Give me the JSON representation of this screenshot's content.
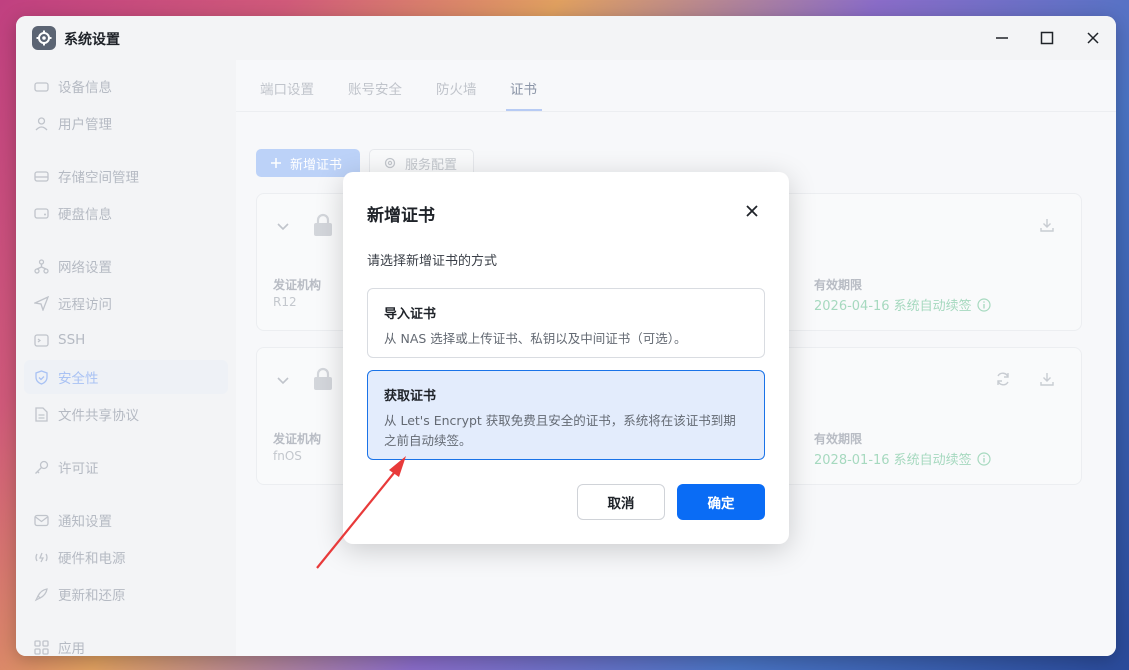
{
  "window": {
    "title": "系统设置"
  },
  "sidebar": {
    "items": [
      {
        "label": "设备信息",
        "icon": "device-icon"
      },
      {
        "label": "用户管理",
        "icon": "user-icon"
      },
      {
        "label": "存储空间管理",
        "icon": "storage-icon"
      },
      {
        "label": "硬盘信息",
        "icon": "disk-icon"
      },
      {
        "label": "网络设置",
        "icon": "network-icon"
      },
      {
        "label": "远程访问",
        "icon": "send-icon"
      },
      {
        "label": "SSH",
        "icon": "terminal-icon"
      },
      {
        "label": "安全性",
        "icon": "shield-icon",
        "active": true
      },
      {
        "label": "文件共享协议",
        "icon": "file-icon"
      },
      {
        "label": "许可证",
        "icon": "key-icon"
      },
      {
        "label": "通知设置",
        "icon": "mail-icon"
      },
      {
        "label": "硬件和电源",
        "icon": "power-icon"
      },
      {
        "label": "更新和还原",
        "icon": "rocket-icon"
      },
      {
        "label": "应用",
        "icon": "apps-icon"
      }
    ]
  },
  "tabs": [
    {
      "label": "端口设置"
    },
    {
      "label": "账号安全"
    },
    {
      "label": "防火墙"
    },
    {
      "label": "证书",
      "active": true
    }
  ],
  "toolbar": {
    "add_label": "新增证书",
    "service_label": "服务配置"
  },
  "certs": [
    {
      "issuer_label": "发证机构",
      "issuer": "R12",
      "expiry_label": "有效期限",
      "expiry": "2026-04-16 系统自动续签"
    },
    {
      "issuer_label": "发证机构",
      "issuer": "fnOS",
      "expiry_label": "有效期限",
      "expiry": "2028-01-16 系统自动续签"
    }
  ],
  "dialog": {
    "title": "新增证书",
    "subtitle": "请选择新增证书的方式",
    "options": [
      {
        "title": "导入证书",
        "desc": "从 NAS 选择或上传证书、私钥以及中间证书（可选）。"
      },
      {
        "title": "获取证书",
        "desc": "从 Let's Encrypt 获取免费且安全的证书，系统将在该证书到期之前自动续签。",
        "selected": true
      }
    ],
    "cancel_label": "取消",
    "ok_label": "确定"
  },
  "colors": {
    "accent": "#0a6cf5",
    "selected_bg": "#e3ecfc",
    "arrow": "#e83a3a"
  }
}
